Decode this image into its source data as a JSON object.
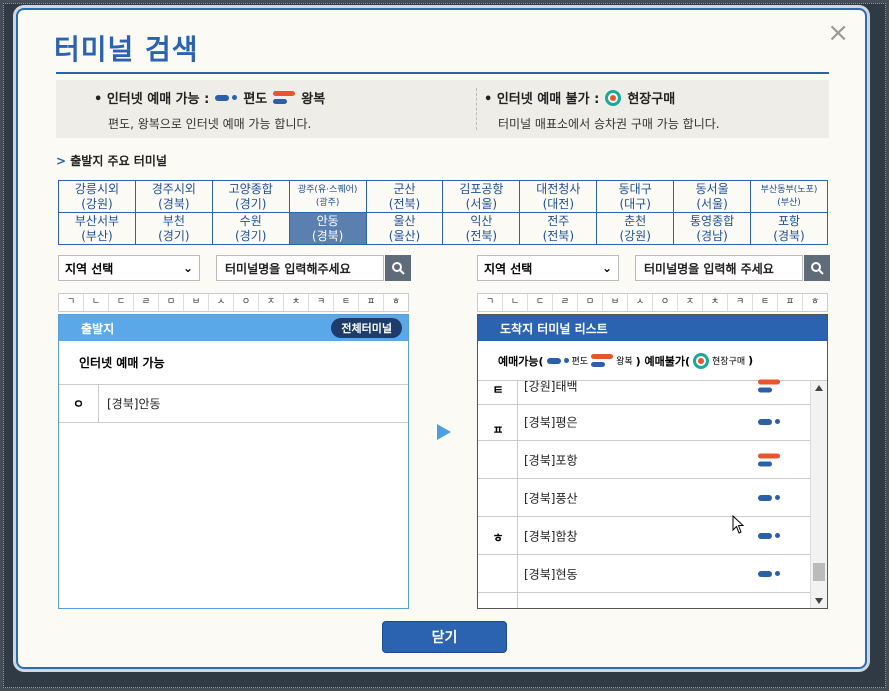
{
  "modal": {
    "title": "터미널 검색",
    "close_label": "×"
  },
  "info": {
    "available_label": "• 인터넷 예매 가능 :",
    "oneway_label": "편도",
    "round_label": "왕복",
    "available_desc": "편도, 왕복으로 인터넷 예매 가능 합니다.",
    "unavailable_label": "• 인터넷 예매 불가 :",
    "onsite_label": "현장구매",
    "unavailable_desc": "터미널 매표소에서 승차권 구매 가능 합니다."
  },
  "major": {
    "title": "출발지 주요 터미널",
    "row1": [
      [
        "강릉시외",
        "(강원)"
      ],
      [
        "경주시외",
        "(경북)"
      ],
      [
        "고양종합",
        "(경기)"
      ],
      [
        "광주(유·스퀘어)",
        "(광주)"
      ],
      [
        "군산",
        "(전북)"
      ],
      [
        "김포공항",
        "(서울)"
      ],
      [
        "대전청사",
        "(대전)"
      ],
      [
        "동대구",
        "(대구)"
      ],
      [
        "동서울",
        "(서울)"
      ],
      [
        "부산동부(노포)",
        "(부산)"
      ]
    ],
    "row2": [
      [
        "부산서부",
        "(부산)"
      ],
      [
        "부천",
        "(경기)"
      ],
      [
        "수원",
        "(경기)"
      ],
      [
        "안동",
        "(경북)"
      ],
      [
        "울산",
        "(울산)"
      ],
      [
        "익산",
        "(전북)"
      ],
      [
        "전주",
        "(전북)"
      ],
      [
        "춘천",
        "(강원)"
      ],
      [
        "통영종합",
        "(경남)"
      ],
      [
        "포항",
        "(경북)"
      ]
    ],
    "selected": "안동"
  },
  "departure": {
    "region_select": "지역 선택",
    "search_placeholder": "터미널명을 입력해주세요",
    "header": "출발지",
    "all_button": "전체터미널",
    "sub": "인터넷 예매 가능",
    "initial": "ㅇ",
    "terminal": "[경북]안동"
  },
  "arrival": {
    "region_select": "지역 선택",
    "search_placeholder": "터미널명을 입력해 주세요",
    "header": "도착지 터미널 리스트",
    "legend_avail": "예매가능(",
    "legend_oneway": "편도",
    "legend_round": "왕복",
    "legend_unavail": ") 예매불가(",
    "legend_onsite": "현장구매",
    "legend_end": ")",
    "initials": [
      "ㅌ",
      "ㅍ",
      "ㅎ"
    ],
    "rows": [
      {
        "name": "[강원]태백",
        "type": "round"
      },
      {
        "name": "[경북]평은",
        "type": "oneway"
      },
      {
        "name": "[경북]포항",
        "type": "round"
      },
      {
        "name": "[경북]풍산",
        "type": "oneway"
      },
      {
        "name": "[경북]함창",
        "type": "oneway"
      },
      {
        "name": "[경북]현동",
        "type": "oneway"
      }
    ]
  },
  "consonants": [
    "ㄱ",
    "ㄴ",
    "ㄷ",
    "ㄹ",
    "ㅁ",
    "ㅂ",
    "ㅅ",
    "ㅇ",
    "ㅈ",
    "ㅊ",
    "ㅋ",
    "ㅌ",
    "ㅍ",
    "ㅎ"
  ],
  "footer": {
    "close_button": "닫기"
  },
  "colors": {
    "primary": "#2b63b0",
    "oneway": "#2b5fa8",
    "round": "#e8552a",
    "onsite": "#1aa89a",
    "selected": "#5b7fae"
  }
}
